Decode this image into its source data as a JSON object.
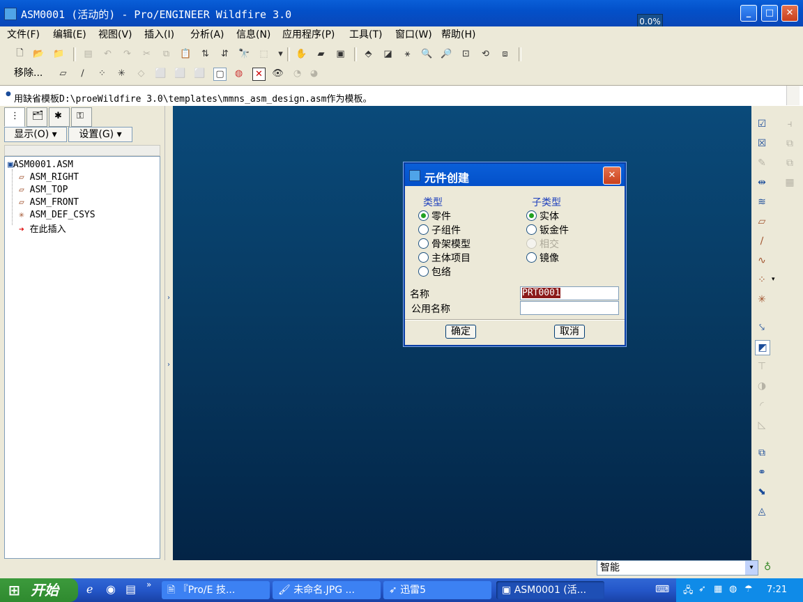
{
  "window": {
    "title": "ASM0001 (活动的) - Pro/ENGINEER Wildfire 3.0",
    "progress": "0.0%"
  },
  "menu": [
    "文件(F)",
    "编辑(E)",
    "视图(V)",
    "插入(I)",
    "分析(A)",
    "信息(N)",
    "应用程序(P)",
    "工具(T)",
    "窗口(W)",
    "帮助(H)"
  ],
  "toolbar": {
    "remove_label": "移除..."
  },
  "message": "用缺省模板D:\\proeWildfire 3.0\\templates\\mmns_asm_design.asm作为模板。",
  "model_tree": {
    "show_button": "显示(O)",
    "settings_button": "设置(G)",
    "root": "ASM0001.ASM",
    "items": [
      "ASM_RIGHT",
      "ASM_TOP",
      "ASM_FRONT",
      "ASM_DEF_CSYS",
      "在此插入"
    ]
  },
  "dialog": {
    "title": "元件创建",
    "type_label": "类型",
    "types": [
      "零件",
      "子组件",
      "骨架模型",
      "主体项目",
      "包络"
    ],
    "selected_type": "零件",
    "subtype_label": "子类型",
    "subtypes": [
      "实体",
      "钣金件",
      "相交",
      "镜像"
    ],
    "selected_subtype": "实体",
    "name_label": "名称",
    "name_value": "PRT0001",
    "common_name_label": "公用名称",
    "common_name_value": "",
    "ok": "确定",
    "cancel": "取消"
  },
  "status": {
    "filter": "智能"
  },
  "taskbar": {
    "start": "开始",
    "tasks": [
      "『Pro/E 技...",
      "未命名.JPG ...",
      "迅雷5",
      "ASM0001 (活..."
    ],
    "clock": "7:21"
  },
  "colors": {
    "graphics_top": "#0a4a7a",
    "graphics_bottom": "#032446",
    "titlebar": "#0350c9",
    "dialog_label": "#1d3fbd"
  }
}
